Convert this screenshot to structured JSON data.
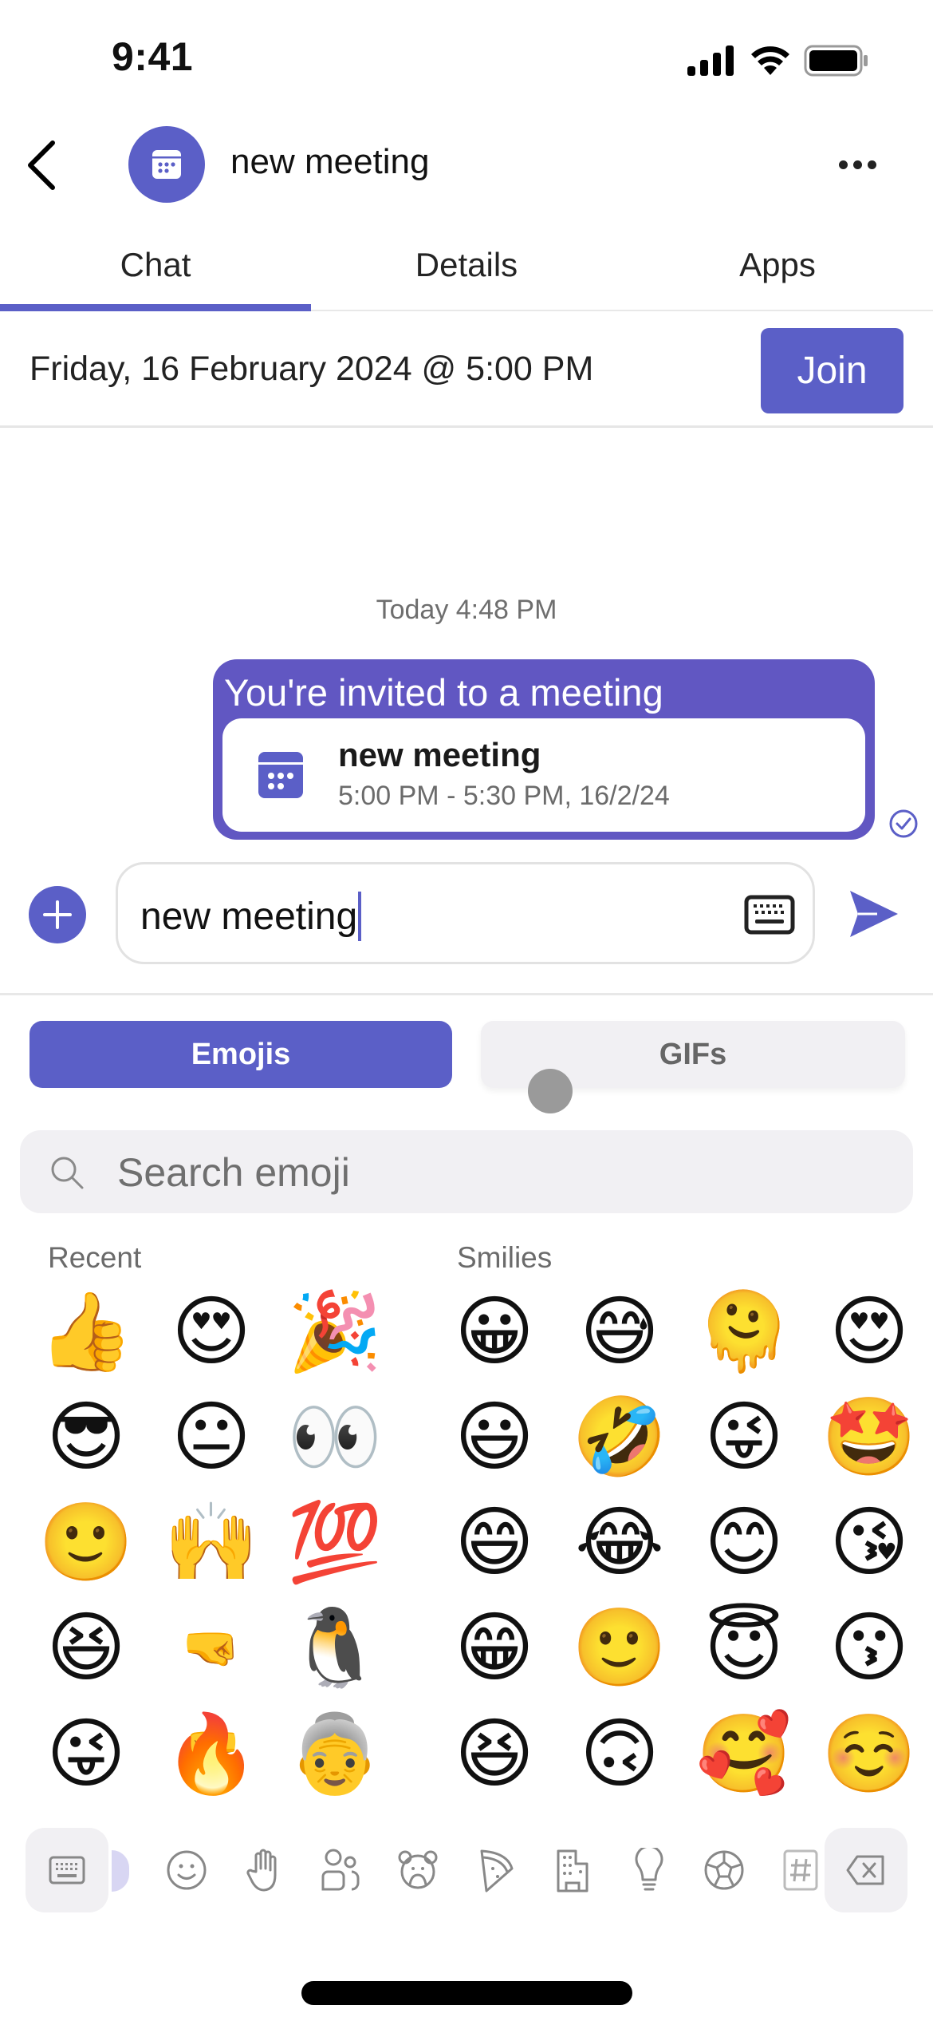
{
  "status_bar": {
    "time": "9:41",
    "icons": [
      "cellular-signal-icon",
      "wifi-icon",
      "battery-icon"
    ]
  },
  "header": {
    "back_icon": "chevron-left-icon",
    "avatar_icon": "calendar-icon",
    "title": "new meeting",
    "more_icon": "ellipsis-icon"
  },
  "tabs": [
    {
      "label": "Chat",
      "active": true
    },
    {
      "label": "Details",
      "active": false
    },
    {
      "label": "Apps",
      "active": false
    }
  ],
  "meeting_banner": {
    "datetime": "Friday, 16 February 2024 @ 5:00 PM",
    "join_label": "Join"
  },
  "messages": {
    "timestamp": "Today 4:48 PM",
    "bubble": {
      "title": "You're invited to a meeting",
      "card": {
        "icon": "calendar-icon",
        "title": "new meeting",
        "subtitle": "5:00 PM - 5:30 PM, 16/2/24"
      },
      "status_icon": "read-check-icon"
    }
  },
  "composer": {
    "plus_icon": "plus-icon",
    "value": "new meeting",
    "keyboard_icon": "keyboard-icon",
    "send_icon": "send-icon"
  },
  "picker": {
    "segments": [
      {
        "label": "Emojis",
        "active": true
      },
      {
        "label": "GIFs",
        "active": false
      }
    ],
    "search_placeholder": "Search emoji",
    "sections": {
      "recent": {
        "label": "Recent",
        "rows": [
          [
            "👍",
            "😍",
            "🎉"
          ],
          [
            "😎",
            "😐",
            "👀"
          ],
          [
            "🙂",
            "🙌",
            "💯"
          ],
          [
            "😆",
            "🤜🤛",
            "🐧"
          ],
          [
            "😜",
            "🔥",
            "👵"
          ]
        ]
      },
      "smilies": {
        "label": "Smilies",
        "rows": [
          [
            "😀",
            "😅",
            "🫠",
            "😍"
          ],
          [
            "😃",
            "🤣",
            "😜",
            "🤩"
          ],
          [
            "😄",
            "😂",
            "😊",
            "😘"
          ],
          [
            "😁",
            "🙂",
            "😇",
            "😗"
          ],
          [
            "😆",
            "🙃",
            "🥰",
            "☺️"
          ]
        ]
      }
    },
    "category_bar": {
      "left_button_icon": "keyboard-icon",
      "categories": [
        "recent-icon",
        "smiley-icon",
        "hand-icon",
        "people-icon",
        "animal-icon",
        "food-icon",
        "building-icon",
        "lightbulb-icon",
        "soccer-ball-icon",
        "symbols-icon"
      ],
      "right_button_icon": "backspace-icon"
    }
  },
  "colors": {
    "accent": "#5b5fc7",
    "bubble": "#6157c2",
    "muted_bg": "#f1f0f3",
    "muted_text": "#6b6b6b"
  }
}
